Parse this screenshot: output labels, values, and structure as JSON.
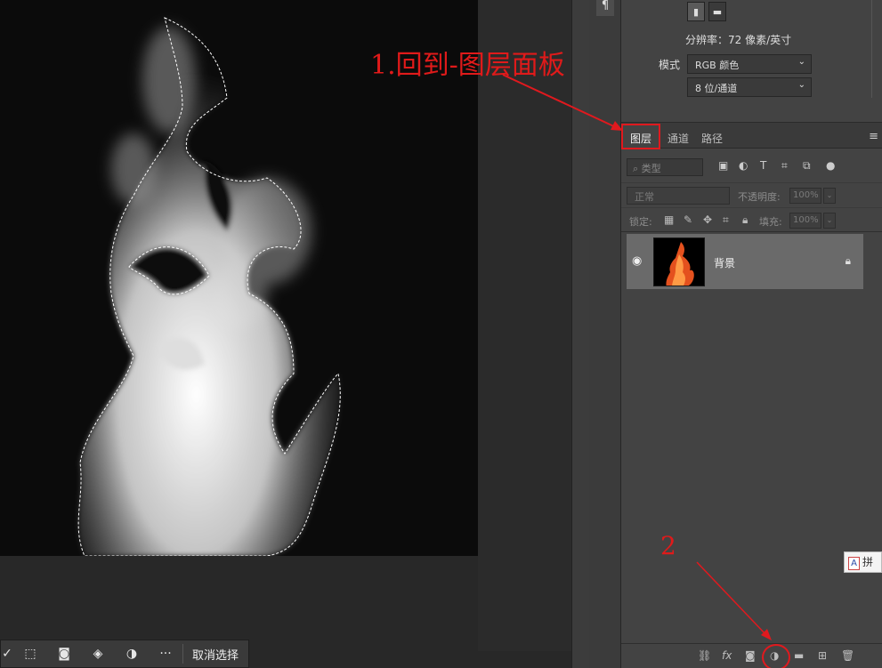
{
  "context_bar": {
    "deselect_label": "取消选择",
    "more_label": "···"
  },
  "properties": {
    "resolution_text": "分辨率：72 像素/英寸",
    "mode_label": "模式",
    "mode_value": "RGB 颜色",
    "bit_depth_value": "8 位/通道"
  },
  "layers_panel": {
    "tabs": [
      {
        "label": "图层",
        "active": true
      },
      {
        "label": "通道",
        "active": false
      },
      {
        "label": "路径",
        "active": false
      }
    ],
    "filter_kind_placeholder": "类型",
    "blend_mode": "正常",
    "opacity_label": "不透明度:",
    "opacity_value": "100%",
    "lock_label": "锁定:",
    "fill_label": "填充:",
    "fill_value": "100%",
    "layers": [
      {
        "name": "背景",
        "visible": true,
        "locked": true
      }
    ],
    "bottom_icons": [
      "link-icon",
      "fx-icon",
      "mask-icon",
      "adjustment-layer-icon",
      "folder-icon",
      "new-layer-icon",
      "trash-icon"
    ],
    "fx_label": "fx"
  },
  "annotations": {
    "step1": "1.回到-图层面板",
    "step2": "2"
  },
  "ime_chip": {
    "text": "拼"
  },
  "colors": {
    "annotation_red": "#e0191e",
    "panel_bg": "#434343",
    "canvas_bg": "#0d0d0d",
    "layer_selected": "#6a6a6a"
  }
}
